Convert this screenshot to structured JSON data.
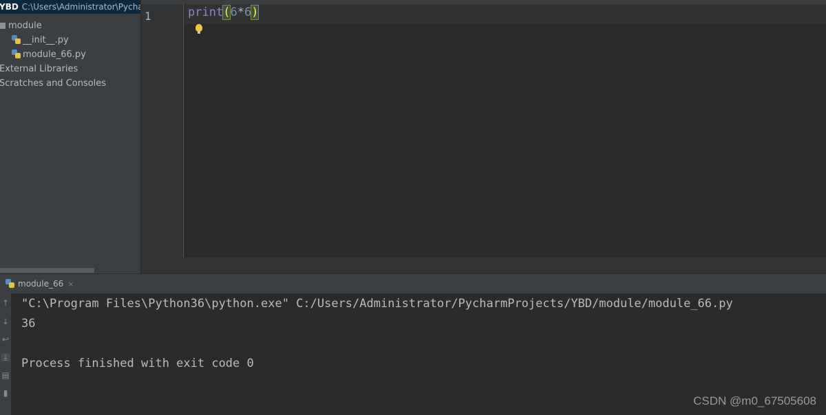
{
  "project": {
    "root_name": "YBD",
    "root_path": "C:\\Users\\Administrator\\PycharmProjects\\YBD",
    "items": [
      {
        "label": "module",
        "icon": "folder-icon"
      },
      {
        "label": "__init__.py",
        "icon": "python-file-icon"
      },
      {
        "label": "module_66.py",
        "icon": "python-file-icon"
      },
      {
        "label": "External Libraries",
        "icon": "library-icon"
      },
      {
        "label": "Scratches and Consoles",
        "icon": "scratches-icon"
      }
    ]
  },
  "editor": {
    "line_number": "1",
    "code": {
      "func": "print",
      "open_paren": "(",
      "expr_a": "6",
      "op": "*",
      "expr_b": "6",
      "close_paren": ")"
    },
    "intention_icon": "lightbulb-icon"
  },
  "run_panel": {
    "tab_label": "module_66",
    "tab_close": "×",
    "toolbar_icons": [
      "arrow-up-icon",
      "arrow-down-icon",
      "soft-wrap-icon",
      "scroll-to-end-icon",
      "print-icon",
      "trash-icon"
    ],
    "console_lines": [
      "\"C:\\Program Files\\Python36\\python.exe\" C:/Users/Administrator/PycharmProjects/YBD/module/module_66.py",
      "36",
      "",
      "Process finished with exit code 0"
    ]
  },
  "watermark": "CSDN @m0_67505608",
  "colors": {
    "editor_bg": "#2b2b2b",
    "panel_bg": "#3c3f41",
    "keyword": "#8888c6",
    "number": "#6897bb",
    "text": "#a9b7c6"
  }
}
